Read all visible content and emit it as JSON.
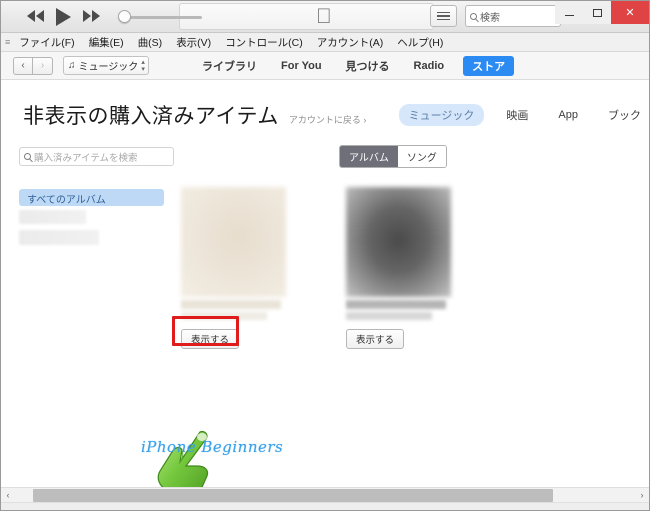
{
  "titlebar": {
    "transport": {
      "rewind_label": "rewind",
      "play_label": "play",
      "forward_label": "fast-forward",
      "volume_value": "0"
    },
    "apple_logo": "",
    "list_button_label": "list-view",
    "search": {
      "placeholder": "検索",
      "value": ""
    },
    "window_controls": {
      "minimize": "–",
      "maximize": "☐",
      "close": "✕"
    }
  },
  "menubar": {
    "grip": "≡",
    "items": [
      {
        "label": "ファイル(F)"
      },
      {
        "label": "編集(E)"
      },
      {
        "label": "曲(S)"
      },
      {
        "label": "表示(V)"
      },
      {
        "label": "コントロール(C)"
      },
      {
        "label": "アカウント(A)"
      },
      {
        "label": "ヘルプ(H)"
      }
    ]
  },
  "navbar": {
    "back_arrow": "‹",
    "forward_arrow": "›",
    "media_select": {
      "icon": "♫",
      "label": "ミュージック",
      "chevron_up": "▴",
      "chevron_down": "▾"
    },
    "tabs": [
      {
        "label": "ライブラリ",
        "active": false
      },
      {
        "label": "For You",
        "active": false
      },
      {
        "label": "見つける",
        "active": false
      },
      {
        "label": "Radio",
        "active": false
      },
      {
        "label": "ストア",
        "active": true
      }
    ]
  },
  "page": {
    "title": "非表示の購入済みアイテム",
    "back_link": "アカウントに戻る ›",
    "category_tabs": [
      {
        "label": "ミュージック",
        "active": true
      },
      {
        "label": "映画",
        "active": false
      },
      {
        "label": "App",
        "active": false
      },
      {
        "label": "ブック",
        "active": false
      }
    ],
    "search_purchased": {
      "placeholder": "購入済みアイテムを検索",
      "value": ""
    },
    "segmented": [
      {
        "label": "アルバム",
        "active": true
      },
      {
        "label": "ソング",
        "active": false
      }
    ]
  },
  "sidebar": {
    "items": [
      {
        "label": "すべてのアルバム",
        "active": true
      }
    ]
  },
  "albums": [
    {
      "show_button_label": "表示する",
      "artwork_tone": "cream",
      "highlighted": true
    },
    {
      "show_button_label": "表示する",
      "artwork_tone": "dark",
      "highlighted": false
    }
  ],
  "annotations": {
    "highlight_color": "#e01b1b",
    "watermark_text": "iPhone Beginners",
    "watermark_color": "#3aa0e8",
    "cursor": "pointing-hand-green"
  },
  "scrollbar": {
    "left_arrow": "‹",
    "right_arrow": "›"
  }
}
